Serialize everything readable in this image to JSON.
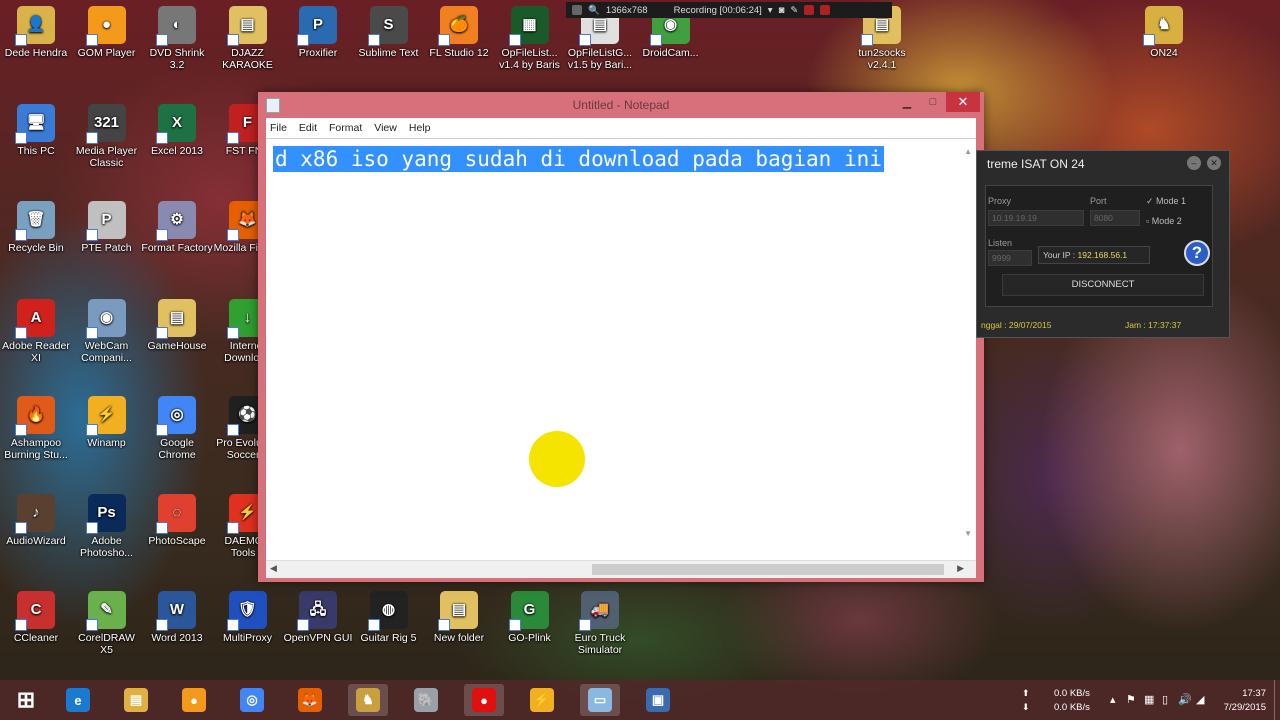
{
  "desktop_icons": [
    {
      "label": "Dede Hendra",
      "color": "#d9b24a",
      "glyph": "👤",
      "col": 0,
      "row": 0
    },
    {
      "label": "This PC",
      "color": "#3a7bd5",
      "glyph": "🖥",
      "col": 0,
      "row": 1
    },
    {
      "label": "Recycle Bin",
      "color": "#7aa0c0",
      "glyph": "🗑",
      "col": 0,
      "row": 2
    },
    {
      "label": "Adobe Reader XI",
      "color": "#d0211c",
      "glyph": "A",
      "col": 0,
      "row": 3
    },
    {
      "label": "Ashampoo Burning Stu...",
      "color": "#e05a1a",
      "glyph": "🔥",
      "col": 0,
      "row": 4
    },
    {
      "label": "AudioWizard",
      "color": "#5a4030",
      "glyph": "♪",
      "col": 0,
      "row": 5
    },
    {
      "label": "CCleaner",
      "color": "#c83030",
      "glyph": "C",
      "col": 0,
      "row": 6
    },
    {
      "label": "GOM Player",
      "color": "#f39a1a",
      "glyph": "●",
      "col": 1,
      "row": 0
    },
    {
      "label": "Media Player Classic",
      "color": "#444",
      "glyph": "321",
      "col": 1,
      "row": 1
    },
    {
      "label": "PTE Patch",
      "color": "#c0c0c0",
      "glyph": "P",
      "col": 1,
      "row": 2
    },
    {
      "label": "WebCam Compani...",
      "color": "#7a9ac0",
      "glyph": "◉",
      "col": 1,
      "row": 3
    },
    {
      "label": "Winamp",
      "color": "#f0b020",
      "glyph": "⚡",
      "col": 1,
      "row": 4
    },
    {
      "label": "Adobe Photosho...",
      "color": "#0a2a5a",
      "glyph": "Ps",
      "col": 1,
      "row": 5
    },
    {
      "label": "CorelDRAW X5",
      "color": "#6ab04c",
      "glyph": "✎",
      "col": 1,
      "row": 6
    },
    {
      "label": "DVD Shrink 3.2",
      "color": "#777",
      "glyph": "◐",
      "col": 2,
      "row": 0
    },
    {
      "label": "Excel 2013",
      "color": "#1e7145",
      "glyph": "X",
      "col": 2,
      "row": 1
    },
    {
      "label": "Format Factory",
      "color": "#8a8ab0",
      "glyph": "⚙",
      "col": 2,
      "row": 2
    },
    {
      "label": "GameHouse",
      "color": "#e0c060",
      "glyph": "▤",
      "col": 2,
      "row": 3
    },
    {
      "label": "Google Chrome",
      "color": "#4285f4",
      "glyph": "◎",
      "col": 2,
      "row": 4
    },
    {
      "label": "PhotoScape",
      "color": "#e04030",
      "glyph": "◌",
      "col": 2,
      "row": 5
    },
    {
      "label": "Word 2013",
      "color": "#2b579a",
      "glyph": "W",
      "col": 2,
      "row": 6
    },
    {
      "label": "DJAZZ KARAOKE",
      "color": "#e0c060",
      "glyph": "▤",
      "col": 3,
      "row": 0
    },
    {
      "label": "FST FNS",
      "color": "#c02020",
      "glyph": "F",
      "col": 3,
      "row": 1
    },
    {
      "label": "Mozilla Firefox",
      "color": "#e66000",
      "glyph": "🦊",
      "col": 3,
      "row": 2
    },
    {
      "label": "Internet Download",
      "color": "#30a030",
      "glyph": "↓",
      "col": 3,
      "row": 3
    },
    {
      "label": "Pro Evolution Soccer 2",
      "color": "#202020",
      "glyph": "⚽",
      "col": 3,
      "row": 4
    },
    {
      "label": "DAEMON Tools L",
      "color": "#e03020",
      "glyph": "⚡",
      "col": 3,
      "row": 5
    },
    {
      "label": "MultiProxy",
      "color": "#2050c0",
      "glyph": "🛡",
      "col": 3,
      "row": 6
    },
    {
      "label": "Proxifier",
      "color": "#2a6ab0",
      "glyph": "P",
      "col": 4,
      "row": 0
    },
    {
      "label": "OpenVPN GUI",
      "color": "#3a3a6a",
      "glyph": "🖧",
      "col": 4,
      "row": 6
    },
    {
      "label": "Sublime Text",
      "color": "#4a4a4a",
      "glyph": "S",
      "col": 5,
      "row": 0
    },
    {
      "label": "Guitar Rig 5",
      "color": "#222",
      "glyph": "◍",
      "col": 5,
      "row": 6
    },
    {
      "label": "FL Studio 12",
      "color": "#f08020",
      "glyph": "🍊",
      "col": 6,
      "row": 0
    },
    {
      "label": "New folder",
      "color": "#e0c060",
      "glyph": "▤",
      "col": 6,
      "row": 6
    },
    {
      "label": "OpFileList... v1.4 by Baris",
      "color": "#1a5a2a",
      "glyph": "▦",
      "col": 7,
      "row": 0
    },
    {
      "label": "GO-Plink",
      "color": "#2a8a3a",
      "glyph": "G",
      "col": 7,
      "row": 6
    },
    {
      "label": "OpFileListG... v1.5 by Bari...",
      "color": "#e0e0e0",
      "glyph": "▤",
      "col": 8,
      "row": 0
    },
    {
      "label": "Euro Truck Simulator",
      "color": "#506070",
      "glyph": "🚚",
      "col": 8,
      "row": 6
    },
    {
      "label": "DroidCam...",
      "color": "#40a040",
      "glyph": "◉",
      "col": 9,
      "row": 0
    },
    {
      "label": "tun2socks v2.4.1",
      "color": "#e0c060",
      "glyph": "▤",
      "col": 12,
      "row": 0
    },
    {
      "label": "ON24",
      "color": "#d8b040",
      "glyph": "♞",
      "col": 16,
      "row": 0
    }
  ],
  "recording_bar": {
    "resolution": "1366x768",
    "status": "Recording [00:06:24]"
  },
  "notepad": {
    "title": "Untitled - Notepad",
    "menu": [
      "File",
      "Edit",
      "Format",
      "View",
      "Help"
    ],
    "selected_text": "d x86 iso yang sudah di download pada bagian ini"
  },
  "isat": {
    "title": "treme ISAT ON 24",
    "proxy_label": "Proxy",
    "proxy_value": "10.19.19.19",
    "port_label": "Port",
    "port_value": "8080",
    "mode1": "Mode 1",
    "mode2": "Mode 2",
    "listen_label": "Listen",
    "listen_value": "9999",
    "your_ip_label": "Your IP :",
    "your_ip_value": "192.168.56.1",
    "disconnect_label": "DISCONNECT",
    "date_text": "nggal : 29/07/2015",
    "time_text": "Jam : 17:37:37"
  },
  "taskbar": {
    "items": [
      {
        "name": "start-button",
        "glyph": "⊞",
        "color": "#ffffff",
        "active": false
      },
      {
        "name": "internet-explorer-icon",
        "glyph": "e",
        "color": "#1a7ad0",
        "active": false
      },
      {
        "name": "file-explorer-icon",
        "glyph": "▤",
        "color": "#e0b040",
        "active": false
      },
      {
        "name": "gom-player-icon",
        "glyph": "●",
        "color": "#f39a1a",
        "active": false
      },
      {
        "name": "chrome-icon",
        "glyph": "◎",
        "color": "#4285f4",
        "active": false
      },
      {
        "name": "firefox-icon",
        "glyph": "🦊",
        "color": "#e66000",
        "active": false
      },
      {
        "name": "on24-icon",
        "glyph": "♞",
        "color": "#c8a040",
        "active": true
      },
      {
        "name": "elephant-icon",
        "glyph": "🐘",
        "color": "#9aa0a8",
        "active": false
      },
      {
        "name": "recorder-icon",
        "glyph": "●",
        "color": "#e01010",
        "active": true
      },
      {
        "name": "winamp-icon",
        "glyph": "⚡",
        "color": "#f0b020",
        "active": false
      },
      {
        "name": "notepad-icon",
        "glyph": "▭",
        "color": "#8ab8e0",
        "active": true
      },
      {
        "name": "virtualbox-icon",
        "glyph": "▣",
        "color": "#3a6ab0",
        "active": false
      }
    ],
    "net_up": "0.0 KB/s",
    "net_down": "0.0 KB/s",
    "time": "17:37",
    "date": "7/29/2015"
  }
}
